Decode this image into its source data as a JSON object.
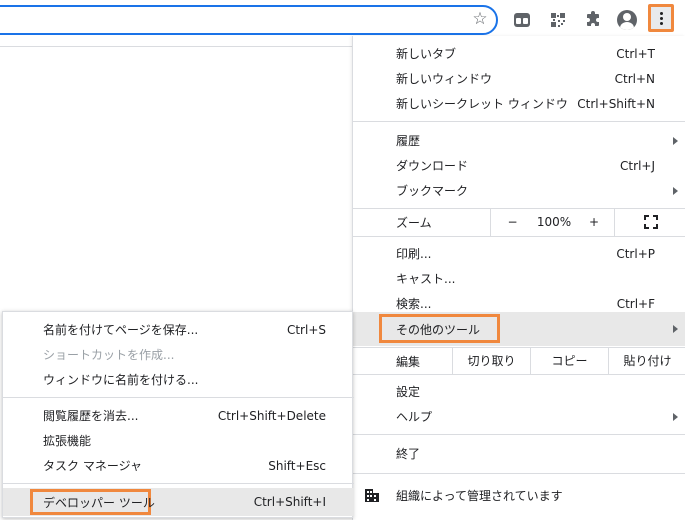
{
  "colors": {
    "highlight": "#f0883e",
    "accent": "#1a73e8",
    "hover": "#e8e8e8"
  },
  "toolbar": {
    "icons": [
      "star-icon",
      "tab-search-icon",
      "qr-code-icon",
      "extensions-icon",
      "profile-icon",
      "kebab-menu-icon"
    ]
  },
  "menu": {
    "new_tab": {
      "label": "新しいタブ",
      "shortcut": "Ctrl+T"
    },
    "new_window": {
      "label": "新しいウィンドウ",
      "shortcut": "Ctrl+N"
    },
    "new_incognito": {
      "label": "新しいシークレット ウィンドウ",
      "shortcut": "Ctrl+Shift+N"
    },
    "history": {
      "label": "履歴"
    },
    "downloads": {
      "label": "ダウンロード",
      "shortcut": "Ctrl+J"
    },
    "bookmarks": {
      "label": "ブックマーク"
    },
    "zoom": {
      "label": "ズーム",
      "minus": "−",
      "value": "100%",
      "plus": "+"
    },
    "print": {
      "label": "印刷...",
      "shortcut": "Ctrl+P"
    },
    "cast": {
      "label": "キャスト..."
    },
    "find": {
      "label": "検索...",
      "shortcut": "Ctrl+F"
    },
    "more_tools": {
      "label": "その他のツール"
    },
    "edit": {
      "label": "編集",
      "cut": "切り取り",
      "copy": "コピー",
      "paste": "貼り付け"
    },
    "settings": {
      "label": "設定"
    },
    "help": {
      "label": "ヘルプ"
    },
    "exit": {
      "label": "終了"
    },
    "managed": {
      "label": "組織によって管理されています"
    }
  },
  "submenu": {
    "save_page": {
      "label": "名前を付けてページを保存...",
      "shortcut": "Ctrl+S"
    },
    "create_shortcut": {
      "label": "ショートカットを作成..."
    },
    "name_window": {
      "label": "ウィンドウに名前を付ける..."
    },
    "clear_data": {
      "label": "閲覧履歴を消去...",
      "shortcut": "Ctrl+Shift+Delete"
    },
    "extensions": {
      "label": "拡張機能"
    },
    "task_manager": {
      "label": "タスク マネージャ",
      "shortcut": "Shift+Esc"
    },
    "devtools": {
      "label": "デベロッパー ツール",
      "shortcut": "Ctrl+Shift+I"
    }
  }
}
